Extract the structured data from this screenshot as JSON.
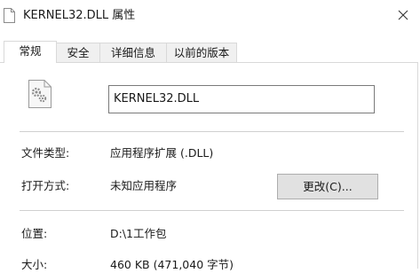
{
  "window": {
    "title": "KERNEL32.DLL 属性",
    "icon": "file-icon",
    "close_glyph": "✕"
  },
  "tabs": [
    {
      "label": "常规",
      "active": true
    },
    {
      "label": "安全",
      "active": false
    },
    {
      "label": "详细信息",
      "active": false
    },
    {
      "label": "以前的版本",
      "active": false
    }
  ],
  "general": {
    "file_icon": "gear-file-icon",
    "file_name": "KERNEL32.DLL",
    "file_type_label": "文件类型:",
    "file_type_value": "应用程序扩展 (.DLL)",
    "open_with_label": "打开方式:",
    "open_with_value": "未知应用程序",
    "change_button": "更改(C)...",
    "location_label": "位置:",
    "location_value": "D:\\1工作包",
    "size_label": "大小:",
    "size_value": "460 KB (471,040 字节)"
  }
}
